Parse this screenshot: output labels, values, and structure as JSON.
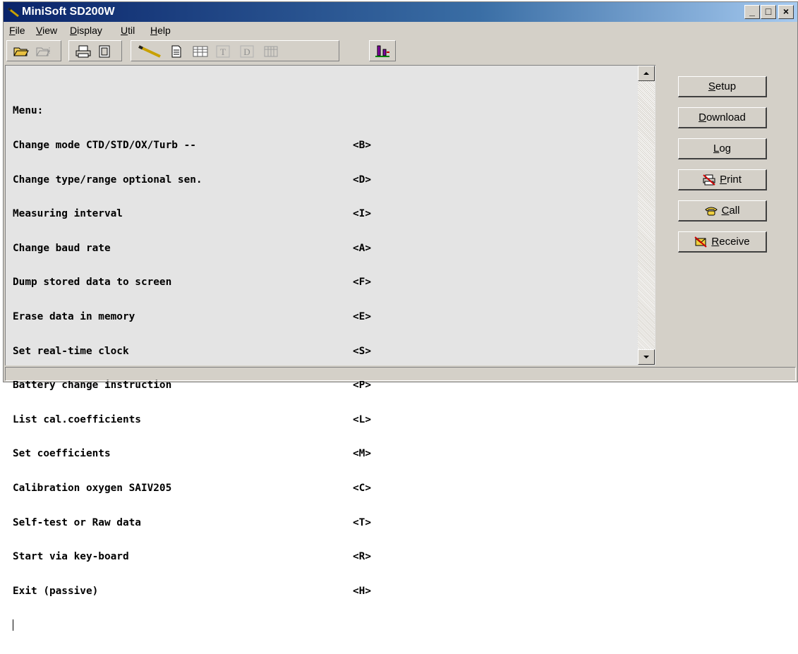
{
  "window": {
    "title": "MiniSoft SD200W"
  },
  "title_buttons": {
    "minimize": "_",
    "maximize": "□",
    "close": "×"
  },
  "menubar": [
    {
      "label": "File",
      "accel": "F",
      "rest": "ile"
    },
    {
      "label": "View",
      "accel": "V",
      "rest": "iew"
    },
    {
      "label": "Display",
      "accel": "D",
      "rest": "isplay"
    },
    {
      "label": "Util",
      "accel": "U",
      "rest": "til"
    },
    {
      "label": "Help",
      "accel": "H",
      "rest": "elp"
    }
  ],
  "toolbar": {
    "icons": [
      "open-folder-icon",
      "open-file-disabled-icon",
      "print-icon",
      "page-icon",
      "pen-icon",
      "document-icon",
      "table-icon",
      "text-t-icon",
      "text-d-icon",
      "grid-icon",
      "chart-icon"
    ]
  },
  "terminal": {
    "header": "Menu:",
    "rows": [
      {
        "text": "Change mode CTD/STD/OX/Turb --",
        "key": "<B>"
      },
      {
        "text": "Change type/range optional sen.",
        "key": "<D>"
      },
      {
        "text": "Measuring interval",
        "key": "<I>"
      },
      {
        "text": "Change baud rate",
        "key": "<A>"
      },
      {
        "text": "Dump stored data to screen",
        "key": "<F>"
      },
      {
        "text": "Erase data in memory",
        "key": "<E>"
      },
      {
        "text": "Set real-time clock",
        "key": "<S>"
      },
      {
        "text": "Battery change instruction",
        "key": "<P>"
      },
      {
        "text": "List cal.coefficients",
        "key": "<L>"
      },
      {
        "text": "Set coefficients",
        "key": "<M>"
      },
      {
        "text": "Calibration oxygen SAIV205",
        "key": "<C>"
      },
      {
        "text": "Self-test or Raw data",
        "key": "<T>"
      },
      {
        "text": "Start via key-board",
        "key": "<R>"
      },
      {
        "text": "Exit (passive)",
        "key": "<H>"
      }
    ]
  },
  "side_buttons": {
    "setup": {
      "accel": "S",
      "rest": "etup"
    },
    "download": {
      "accel": "D",
      "rest": "ownload"
    },
    "log": {
      "accel": "L",
      "rest": "og"
    },
    "print": {
      "accel": "P",
      "rest": "rint"
    },
    "call": {
      "accel": "C",
      "rest": "all"
    },
    "receive": {
      "accel": "R",
      "rest": "eceive"
    }
  },
  "statusbar": {
    "text": ""
  },
  "colors": {
    "titlebar": "#0a246a",
    "face": "#d4d0c8",
    "terminal_bg": "#e4e4e4"
  }
}
